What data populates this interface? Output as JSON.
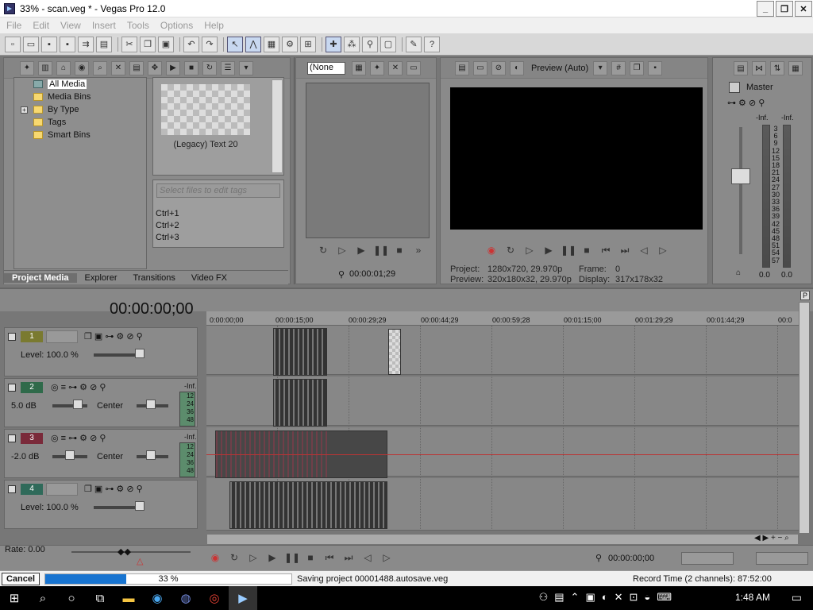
{
  "window": {
    "title": "33% - scan.veg * - Vegas Pro 12.0",
    "buttons": [
      "_",
      "❐",
      "✕"
    ]
  },
  "menu": [
    "File",
    "Edit",
    "View",
    "Insert",
    "Tools",
    "Options",
    "Help"
  ],
  "toolbar_icons": [
    "new-icon",
    "open-icon",
    "save-icon",
    "save-as-icon",
    "render-icon",
    "properties-icon",
    "cut-icon",
    "copy-icon",
    "paste-icon",
    "undo-icon",
    "redo-icon",
    "normal-edit-tool-icon",
    "envelope-tool-icon",
    "selection-tool-icon",
    "ripple-icon",
    "snap-icon",
    "auto-crossfade-icon",
    "lock-envelopes-icon",
    "ignore-grouping-icon",
    "help-icon"
  ],
  "project_media": {
    "tree": [
      "All Media",
      "Media Bins",
      "By Type",
      "Tags",
      "Smart Bins"
    ],
    "thumb_label": "(Legacy) Text 20",
    "tag_placeholder": "Select files to edit tags",
    "shortcuts": [
      "Ctrl+1",
      "Ctrl+2",
      "Ctrl+3"
    ],
    "tabs": [
      "Project Media",
      "Explorer",
      "Transitions",
      "Video FX"
    ]
  },
  "trimmer": {
    "dropdown": "(None",
    "time": "00:00:01;29"
  },
  "preview": {
    "mode": "Preview (Auto)",
    "project_label": "Project:",
    "project_value": "1280x720, 29.970p",
    "preview_label": "Preview:",
    "preview_value": "320x180x32, 29.970p",
    "frame_label": "Frame:",
    "frame_value": "0",
    "display_label": "Display:",
    "display_value": "317x178x32"
  },
  "master": {
    "title": "Master",
    "peak_left": "-Inf.",
    "peak_right": "-Inf.",
    "scale": [
      "3",
      "6",
      "9",
      "12",
      "15",
      "18",
      "21",
      "24",
      "27",
      "30",
      "33",
      "36",
      "39",
      "42",
      "45",
      "48",
      "51",
      "54",
      "57"
    ],
    "level_left": "0.0",
    "level_right": "0.0"
  },
  "timeline": {
    "time": "00:00:00;00",
    "ruler": [
      "0:00:00;00",
      "00:00:15;00",
      "00:00:29;29",
      "00:00:44;29",
      "00:00:59;28",
      "00:01:15;00",
      "00:01:29;29",
      "00:01:44;29",
      "00:0"
    ],
    "tracks": [
      {
        "num": "1",
        "type": "video",
        "label": "Level: 100.0 %",
        "color": "#7a7a30"
      },
      {
        "num": "2",
        "type": "audio",
        "vol": "5.0 dB",
        "pan": "Center",
        "meter_top": "-Inf.",
        "meter": [
          "12",
          "24",
          "36",
          "48"
        ],
        "color": "#2f6a4a"
      },
      {
        "num": "3",
        "type": "audio",
        "vol": "-2.0 dB",
        "pan": "Center",
        "meter_top": "-Inf.",
        "meter": [
          "12",
          "24",
          "36",
          "48"
        ],
        "color": "#7a2a3a"
      },
      {
        "num": "4",
        "type": "video",
        "label": "Level: 100.0 %",
        "color": "#2f6a5a"
      }
    ],
    "rate": "Rate: 0.00",
    "cursor_time": "00:00:00;00"
  },
  "status": {
    "cancel": "Cancel",
    "progress": 0.33,
    "progress_label": "33 %",
    "message": "Saving project 00001488.autosave.veg",
    "record": "Record Time (2 channels): 87:52:00"
  },
  "taskbar": {
    "clock": "1:48 AM"
  }
}
